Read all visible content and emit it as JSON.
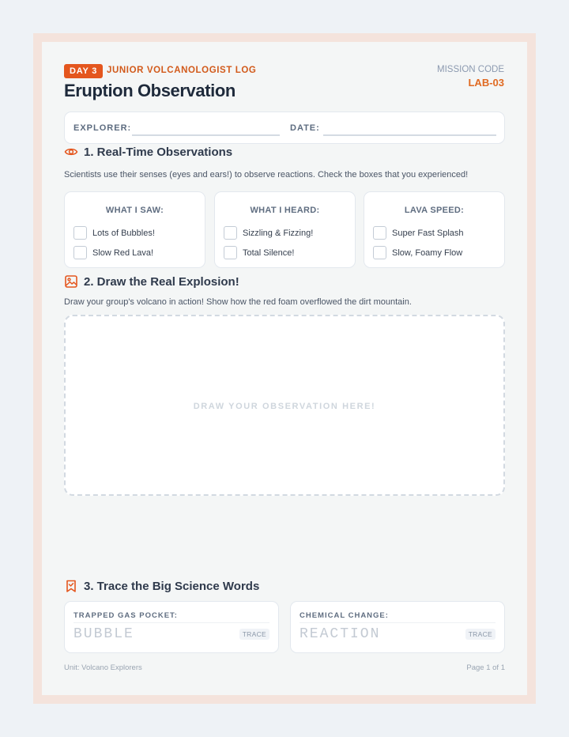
{
  "header": {
    "day_badge": "DAY 3",
    "log_title": "JUNIOR VOLCANOLOGIST LOG",
    "mission_label": "MISSION CODE",
    "mission_code": "LAB-03",
    "title": "Eruption Observation"
  },
  "fields": {
    "explorer_label": "EXPLORER:",
    "explorer_value": "",
    "date_label": "DATE:",
    "date_value": ""
  },
  "section1": {
    "title": "1. Real-Time Observations",
    "icon": "eye-icon",
    "description": "Scientists use their senses (eyes and ears!) to observe reactions. Check the boxes that you experienced!",
    "cards": [
      {
        "title": "WHAT I SAW:",
        "options": [
          {
            "label": "Lots of Bubbles!",
            "checked": false
          },
          {
            "label": "Slow Red Lava!",
            "checked": false
          }
        ]
      },
      {
        "title": "WHAT I HEARD:",
        "options": [
          {
            "label": "Sizzling & Fizzing!",
            "checked": false
          },
          {
            "label": "Total Silence!",
            "checked": false
          }
        ]
      },
      {
        "title": "LAVA SPEED:",
        "options": [
          {
            "label": "Super Fast Splash",
            "checked": false
          },
          {
            "label": "Slow, Foamy Flow",
            "checked": false
          }
        ]
      }
    ]
  },
  "section2": {
    "title": "2. Draw the Real Explosion!",
    "icon": "image-icon",
    "description": "Draw your group's volcano in action! Show how the red foam overflowed the dirt mountain.",
    "draw_hint": "DRAW YOUR OBSERVATION HERE!"
  },
  "section3": {
    "title": "3. Trace the Big Science Words",
    "icon": "bookmark-icon",
    "words": [
      {
        "label": "TRAPPED GAS POCKET:",
        "word": "BUBBLE",
        "tag": "TRACE"
      },
      {
        "label": "CHEMICAL CHANGE:",
        "word": "REACTION",
        "tag": "TRACE"
      }
    ]
  },
  "footer": {
    "unit": "Unit: Volcano Explorers",
    "page": "Page 1 of 1"
  },
  "colors": {
    "accent": "#e4561e",
    "page_border": "#f4e3dc",
    "paper": "#f4f6f6",
    "heading": "#1e2a3b"
  }
}
